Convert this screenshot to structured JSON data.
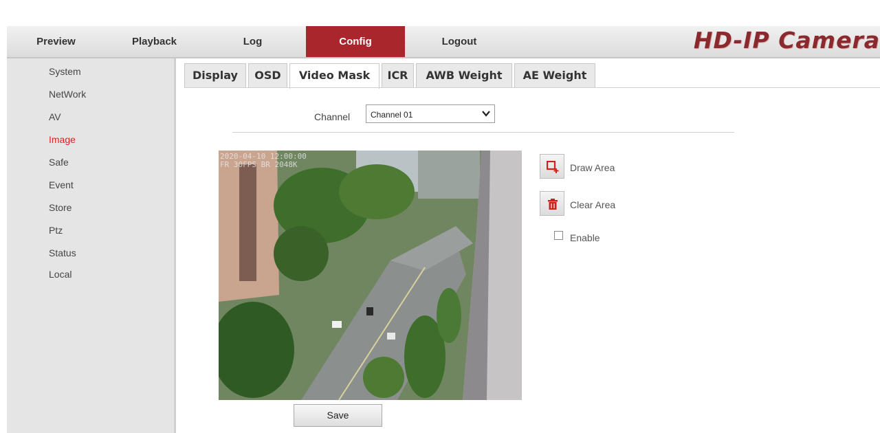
{
  "nav": {
    "tabs": [
      "Preview",
      "Playback",
      "Log",
      "Config",
      "Logout"
    ],
    "active": "Config",
    "brand": "HD-IP Camera"
  },
  "sidebar": {
    "items": [
      "System",
      "NetWork",
      "AV",
      "Image",
      "Safe",
      "Event",
      "Store",
      "Ptz",
      "Status",
      "Local"
    ],
    "active": "Image"
  },
  "tabs": {
    "items": [
      "Display",
      "OSD",
      "Video Mask",
      "ICR",
      "AWB Weight",
      "AE Weight"
    ],
    "active": "Video Mask"
  },
  "channel": {
    "label": "Channel",
    "value": "Channel 01"
  },
  "actions": {
    "draw_area": "Draw Area",
    "clear_area": "Clear Area",
    "enable": "Enable",
    "enable_checked": false,
    "draw_icon": "draw-rectangle-icon",
    "clear_icon": "trash-icon"
  },
  "save_label": "Save",
  "colors": {
    "accent": "#a8262c",
    "active_link": "#e0201a"
  }
}
